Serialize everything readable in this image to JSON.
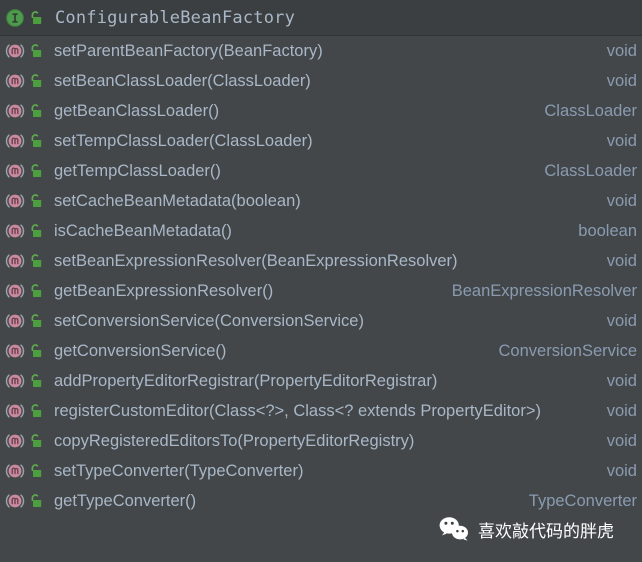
{
  "header": {
    "title": "ConfigurableBeanFactory",
    "type_icon": "interface-icon",
    "visibility_icon": "public-unlocked-icon"
  },
  "colors": {
    "header_bg": "#3c3f41",
    "list_bg": "#43474a",
    "text": "#a9b7c6",
    "return_type_text": "#8a9bb0",
    "interface_icon_green": "#4e9a4e",
    "method_icon_pink": "#c98a9e",
    "lock_icon_green": "#4c9e3f",
    "watermark_text": "#ffffff"
  },
  "members": [
    {
      "signature": "setParentBeanFactory(BeanFactory)",
      "return_type": "void",
      "icon": "method-icon",
      "visibility_icon": "public-unlocked-icon"
    },
    {
      "signature": "setBeanClassLoader(ClassLoader)",
      "return_type": "void",
      "icon": "method-icon",
      "visibility_icon": "public-unlocked-icon"
    },
    {
      "signature": "getBeanClassLoader()",
      "return_type": "ClassLoader",
      "icon": "method-icon",
      "visibility_icon": "public-unlocked-icon"
    },
    {
      "signature": "setTempClassLoader(ClassLoader)",
      "return_type": "void",
      "icon": "method-icon",
      "visibility_icon": "public-unlocked-icon"
    },
    {
      "signature": "getTempClassLoader()",
      "return_type": "ClassLoader",
      "icon": "method-icon",
      "visibility_icon": "public-unlocked-icon"
    },
    {
      "signature": "setCacheBeanMetadata(boolean)",
      "return_type": "void",
      "icon": "method-icon",
      "visibility_icon": "public-unlocked-icon"
    },
    {
      "signature": "isCacheBeanMetadata()",
      "return_type": "boolean",
      "icon": "method-icon",
      "visibility_icon": "public-unlocked-icon"
    },
    {
      "signature": "setBeanExpressionResolver(BeanExpressionResolver)",
      "return_type": "void",
      "icon": "method-icon",
      "visibility_icon": "public-unlocked-icon"
    },
    {
      "signature": "getBeanExpressionResolver()",
      "return_type": "BeanExpressionResolver",
      "icon": "method-icon",
      "visibility_icon": "public-unlocked-icon"
    },
    {
      "signature": "setConversionService(ConversionService)",
      "return_type": "void",
      "icon": "method-icon",
      "visibility_icon": "public-unlocked-icon"
    },
    {
      "signature": "getConversionService()",
      "return_type": "ConversionService",
      "icon": "method-icon",
      "visibility_icon": "public-unlocked-icon"
    },
    {
      "signature": "addPropertyEditorRegistrar(PropertyEditorRegistrar)",
      "return_type": "void",
      "icon": "method-icon",
      "visibility_icon": "public-unlocked-icon"
    },
    {
      "signature": "registerCustomEditor(Class<?>, Class<? extends PropertyEditor>)",
      "return_type": "void",
      "icon": "method-icon",
      "visibility_icon": "public-unlocked-icon"
    },
    {
      "signature": "copyRegisteredEditorsTo(PropertyEditorRegistry)",
      "return_type": "void",
      "icon": "method-icon",
      "visibility_icon": "public-unlocked-icon"
    },
    {
      "signature": "setTypeConverter(TypeConverter)",
      "return_type": "void",
      "icon": "method-icon",
      "visibility_icon": "public-unlocked-icon"
    },
    {
      "signature": "getTypeConverter()",
      "return_type": "TypeConverter",
      "icon": "method-icon",
      "visibility_icon": "public-unlocked-icon"
    }
  ],
  "watermark": {
    "logo": "wechat-logo",
    "text": "喜欢敲代码的胖虎"
  }
}
